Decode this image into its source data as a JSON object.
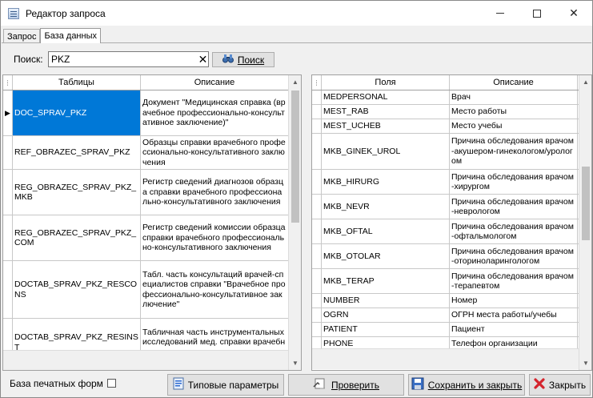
{
  "window": {
    "title": "Редактор запроса",
    "minimize_glyph": "—",
    "maximize_glyph": "☐",
    "close_glyph": "✕"
  },
  "tabs": [
    {
      "label": "Запрос"
    },
    {
      "label": "База данных"
    }
  ],
  "search": {
    "label": "Поиск:",
    "value": "PKZ",
    "button_label": "Поиск",
    "clear_glyph": "✕"
  },
  "tables_grid": {
    "columns": [
      "Таблицы",
      "Описание"
    ],
    "rows": [
      {
        "name": "DOC_SPRAV_PKZ",
        "desc": "Документ \"Медицинская справка (врачебное профессионально-консультативное заключение)\"",
        "selected": true
      },
      {
        "name": "REF_OBRAZEC_SPRAV_PKZ",
        "desc": "Образцы справки врачебного профессионально-консультативного заключения"
      },
      {
        "name": "REG_OBRAZEC_SPRAV_PKZ_MKB",
        "desc": "Регистр сведений диагнозов образца справки врачебного профессионально-консультативного заключения"
      },
      {
        "name": "REG_OBRAZEC_SPRAV_PKZ_COM",
        "desc": "Регистр сведений комиссии образца справки врачебного профессионально-консультативного заключения"
      },
      {
        "name": "DOCTAB_SPRAV_PKZ_RESCONS",
        "desc": "Табл. часть консультаций врачей-специалистов справки \"Врачебное профессионально-консультативное заключение\""
      },
      {
        "name": "DOCTAB_SPRAV_PKZ_RESINST",
        "desc": "Табличная часть инструментальных исследований мед. справки врачебного"
      }
    ]
  },
  "fields_grid": {
    "columns": [
      "Поля",
      "Описание"
    ],
    "rows": [
      {
        "name": "MEDPERSONAL",
        "desc": "Врач"
      },
      {
        "name": "MEST_RAB",
        "desc": "Место работы"
      },
      {
        "name": "MEST_UCHEB",
        "desc": "Место учебы"
      },
      {
        "name": "MKB_GINEK_UROL",
        "desc": "Причина обследования врачом-акушером-гинекологом/урологом"
      },
      {
        "name": "MKB_HIRURG",
        "desc": "Причина обследования врачом-хирургом"
      },
      {
        "name": "MKB_NEVR",
        "desc": "Причина обследования врачом-неврологом"
      },
      {
        "name": "MKB_OFTAL",
        "desc": "Причина обследования врачом-офтальмологом"
      },
      {
        "name": "MKB_OTOLAR",
        "desc": "Причина обследования врачом-оториноларингологом"
      },
      {
        "name": "MKB_TERAP",
        "desc": "Причина обследования врачом-терапевтом"
      },
      {
        "name": "NUMBER",
        "desc": "Номер"
      },
      {
        "name": "OGRN",
        "desc": "ОГРН места работы/учебы"
      },
      {
        "name": "PATIENT",
        "desc": "Пациент"
      },
      {
        "name": "PHONE",
        "desc": "Телефон организации"
      }
    ]
  },
  "footer": {
    "print_forms_label": "База печатных форм",
    "print_forms_checked": false,
    "typical_params_label": "Типовые параметры",
    "check_label": "Проверить",
    "save_close_label": "Сохранить и закрыть",
    "close_label": "Закрыть"
  },
  "icons": {
    "app": "query-editor-icon",
    "search": "binoculars-icon",
    "typical_params": "parameters-icon",
    "check": "check-document-icon",
    "save": "floppy-disk-icon",
    "close": "red-x-icon"
  },
  "colors": {
    "selection": "#0078d7",
    "close_x": "#d4242d"
  }
}
